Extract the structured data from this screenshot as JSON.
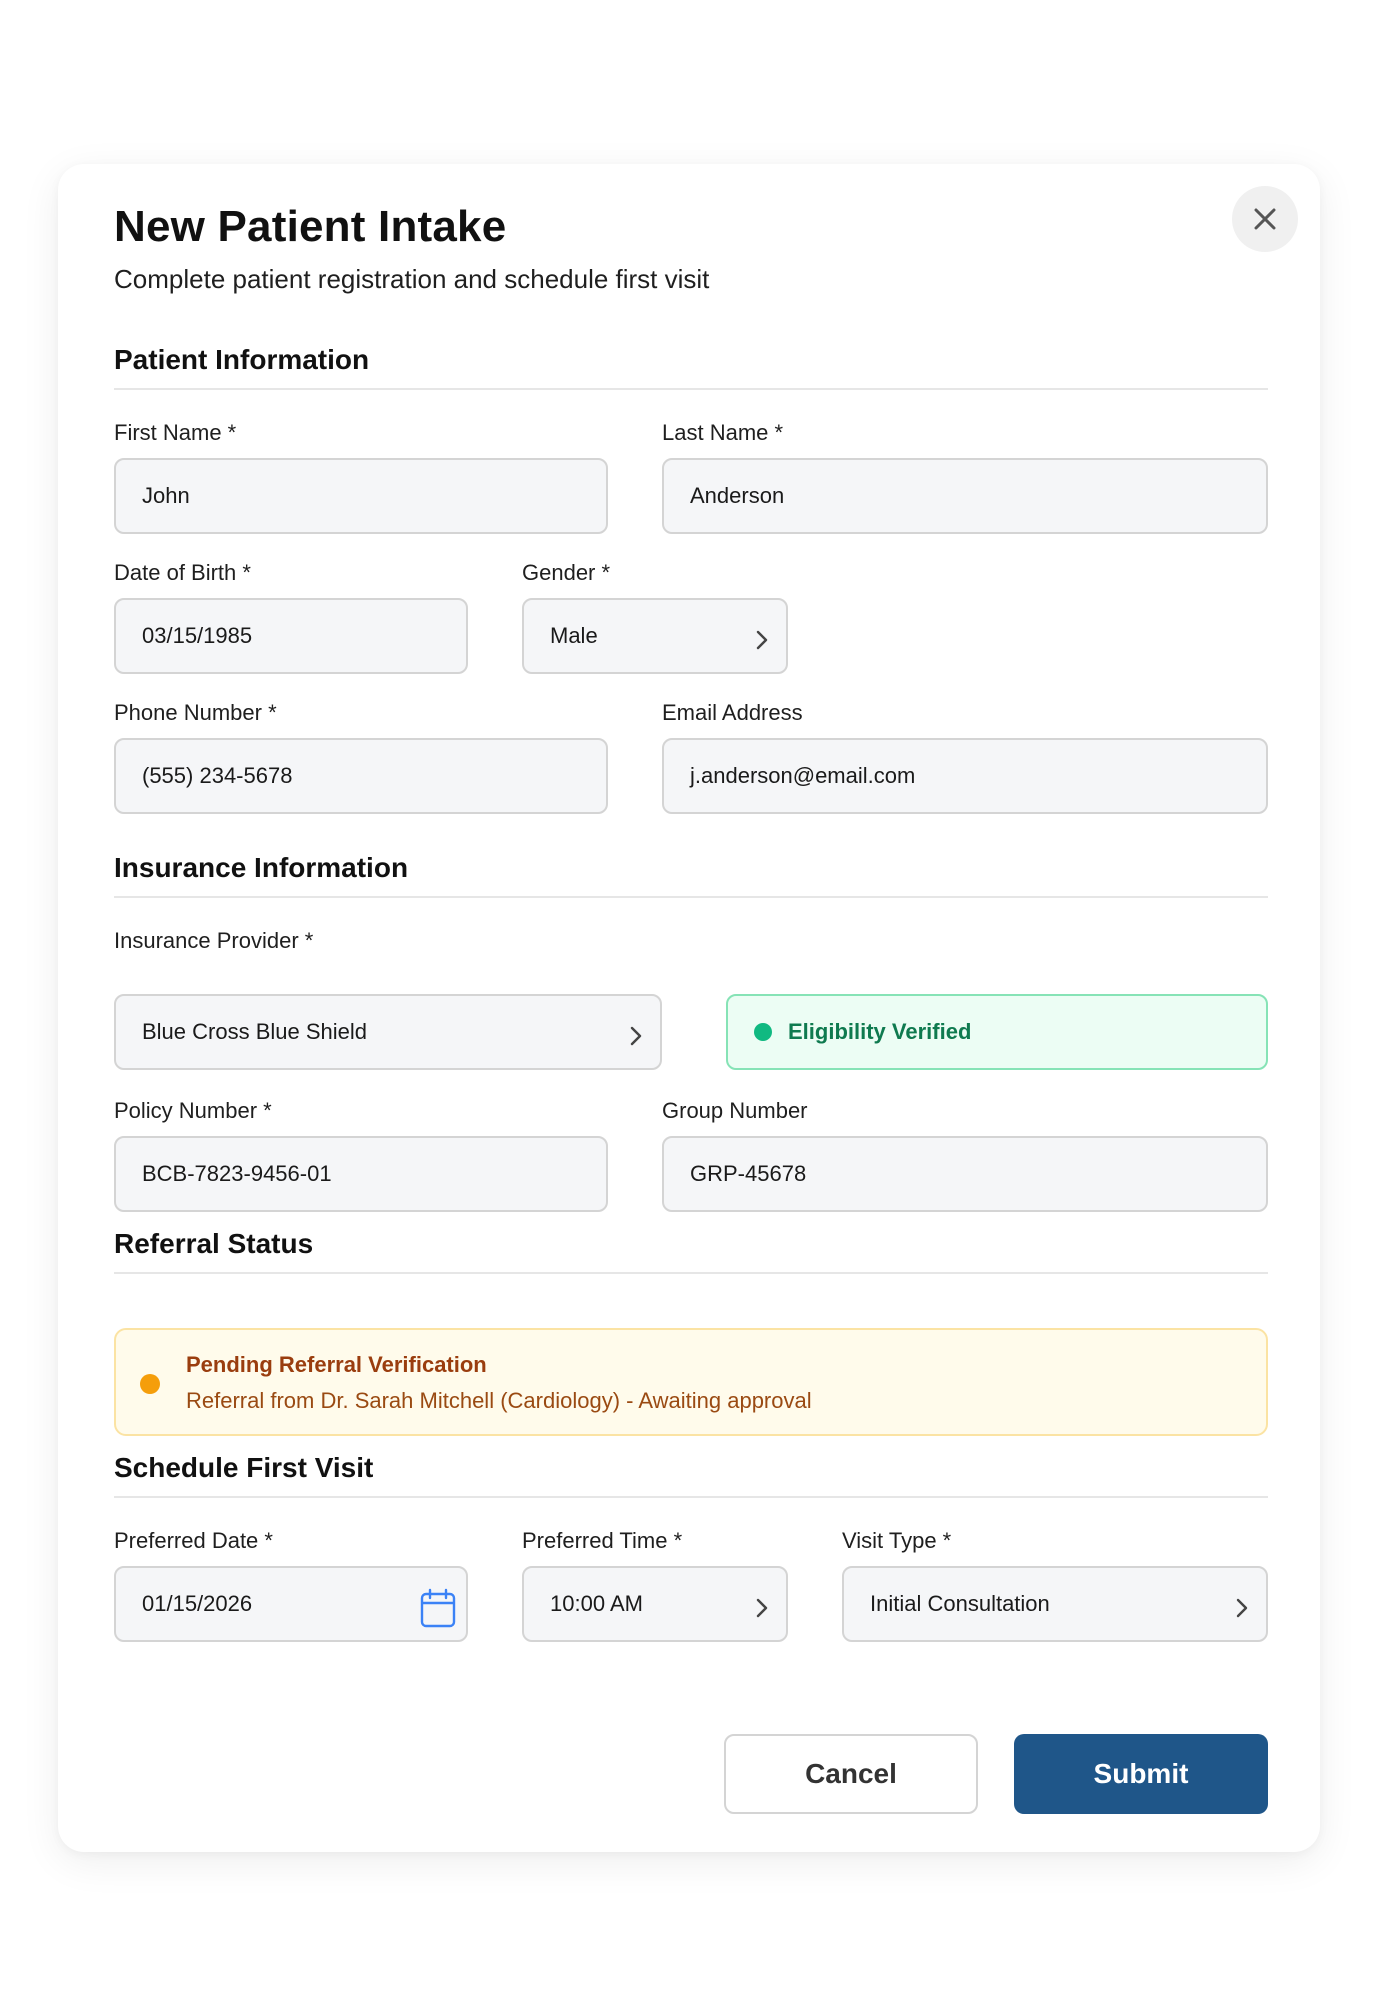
{
  "modal": {
    "title": "New Patient Intake",
    "subtitle": "Complete patient registration and schedule first visit"
  },
  "sections": {
    "patient": "Patient Information",
    "insurance": "Insurance Information",
    "referral": "Referral Status",
    "schedule": "Schedule First Visit"
  },
  "patient": {
    "first_name_label": "First Name *",
    "first_name": "John",
    "last_name_label": "Last Name *",
    "last_name": "Anderson",
    "dob_label": "Date of Birth *",
    "dob": "03/15/1985",
    "gender_label": "Gender *",
    "gender": "Male",
    "phone_label": "Phone Number *",
    "phone": "(555) 234-5678",
    "email_label": "Email Address",
    "email": "j.anderson@email.com"
  },
  "insurance": {
    "provider_label": "Insurance Provider *",
    "provider": "Blue Cross Blue Shield",
    "eligibility": "Eligibility Verified",
    "policy_label": "Policy Number *",
    "policy": "BCB-7823-9456-01",
    "group_label": "Group Number",
    "group": "GRP-45678"
  },
  "referral": {
    "title": "Pending Referral Verification",
    "description": "Referral from Dr. Sarah Mitchell (Cardiology) - Awaiting approval"
  },
  "schedule": {
    "date_label": "Preferred Date *",
    "date": "01/15/2026",
    "time_label": "Preferred Time *",
    "time": "10:00 AM",
    "visit_type_label": "Visit Type *",
    "visit_type": "Initial Consultation"
  },
  "actions": {
    "cancel": "Cancel",
    "submit": "Submit"
  },
  "colors": {
    "primary": "#1f5689",
    "success": "#10b981",
    "warning": "#f59e0b"
  },
  "icons": {
    "close": "close-icon",
    "chevron": "chevron-right-icon",
    "calendar": "calendar-icon"
  }
}
